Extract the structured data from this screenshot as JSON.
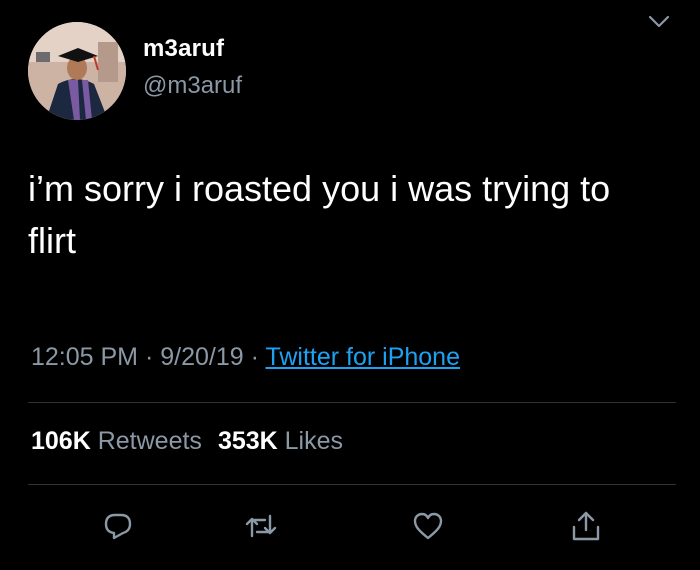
{
  "header": {
    "display_name": "m3aruf",
    "handle": "@m3aruf",
    "menu_icon": "chevron-down-icon"
  },
  "tweet": {
    "text": "i’m sorry i roasted you i was trying to flirt",
    "time": "12:05 PM",
    "date": "9/20/19",
    "separator": "·",
    "source": "Twitter for iPhone"
  },
  "stats": {
    "retweets_count": "106K",
    "retweets_label": "Retweets",
    "likes_count": "353K",
    "likes_label": "Likes"
  },
  "actions": [
    {
      "icon": "reply-icon"
    },
    {
      "icon": "retweet-icon"
    },
    {
      "icon": "like-icon"
    },
    {
      "icon": "share-icon"
    }
  ],
  "colors": {
    "background": "#000000",
    "primary_text": "#ffffff",
    "secondary_text": "#8b98a5",
    "link": "#1da1f2",
    "divider": "#2f3336"
  }
}
